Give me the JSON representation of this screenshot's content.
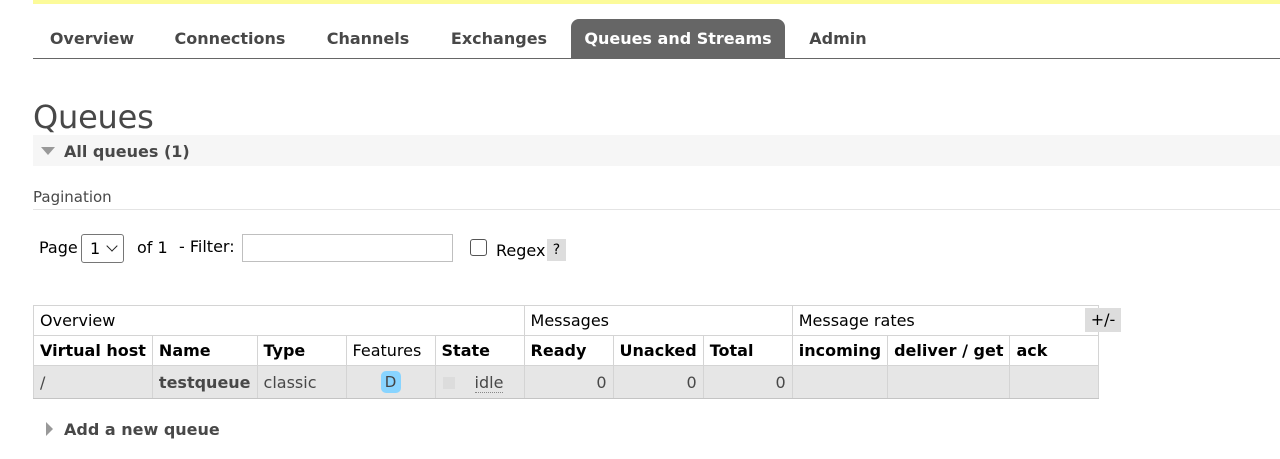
{
  "nav": {
    "tabs": [
      {
        "label": "Overview",
        "active": false
      },
      {
        "label": "Connections",
        "active": false
      },
      {
        "label": "Channels",
        "active": false
      },
      {
        "label": "Exchanges",
        "active": false
      },
      {
        "label": "Queues and Streams",
        "active": true
      },
      {
        "label": "Admin",
        "active": false
      }
    ]
  },
  "page": {
    "title": "Queues",
    "section_label": "All queues (1)"
  },
  "pagination": {
    "heading": "Pagination",
    "page_label": "Page",
    "page_value": "1",
    "of_label": "of 1",
    "filter_label": "- Filter:",
    "filter_value": "",
    "regex_label": "Regex",
    "regex_checked": false,
    "help_label": "?"
  },
  "table": {
    "groups": [
      "Overview",
      "Messages",
      "Message rates"
    ],
    "columns": [
      "Virtual host",
      "Name",
      "Type",
      "Features",
      "State",
      "Ready",
      "Unacked",
      "Total",
      "incoming",
      "deliver / get",
      "ack"
    ],
    "rows": [
      {
        "virtual_host": "/",
        "name": "testqueue",
        "type": "classic",
        "features": "D",
        "state": "idle",
        "ready": "0",
        "unacked": "0",
        "total": "0",
        "incoming": "",
        "deliver_get": "",
        "ack": ""
      }
    ],
    "columns_toggle_label": "+/-"
  },
  "add_queue": {
    "label": "Add a new queue"
  },
  "colors": {
    "active_tab": "#666666",
    "top_strip": "#fcfb9a",
    "feature_badge": "#88d4ff",
    "row_background": "#e6e6e6"
  }
}
